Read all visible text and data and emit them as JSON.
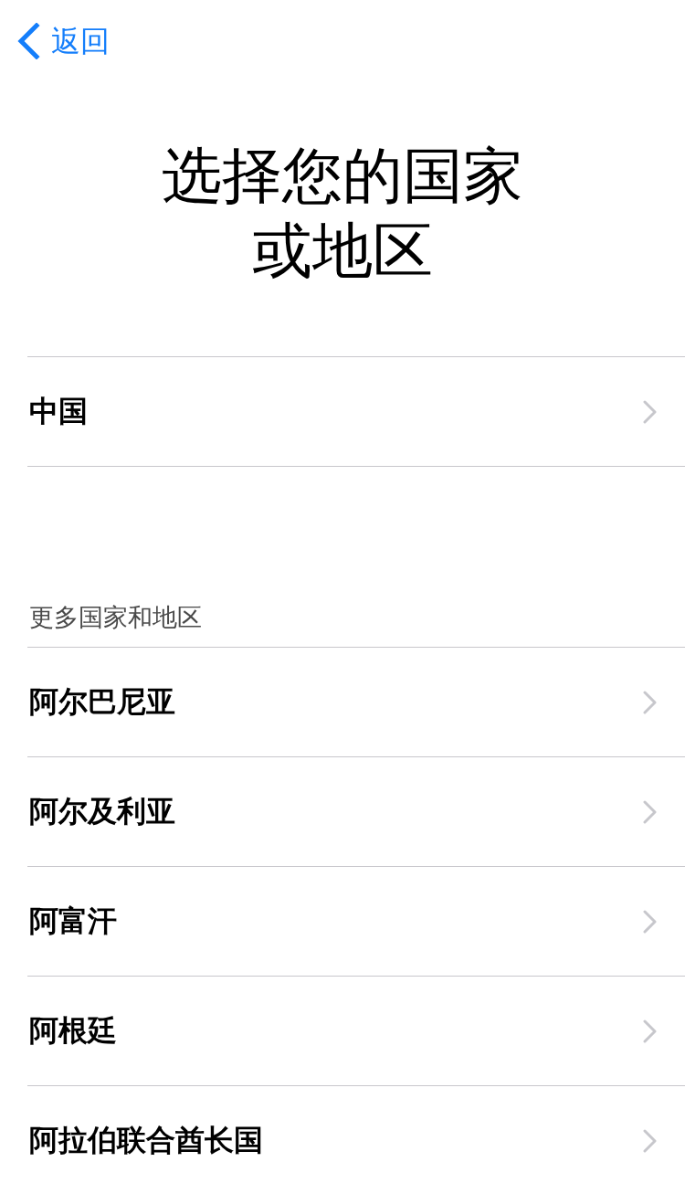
{
  "nav": {
    "back_label": "返回"
  },
  "title": "选择您的国家或地区",
  "featured": [
    {
      "name": "中国"
    }
  ],
  "more": {
    "header": "更多国家和地区",
    "items": [
      {
        "name": "阿尔巴尼亚"
      },
      {
        "name": "阿尔及利亚"
      },
      {
        "name": "阿富汗"
      },
      {
        "name": "阿根廷"
      },
      {
        "name": "阿拉伯联合酋长国"
      }
    ]
  }
}
